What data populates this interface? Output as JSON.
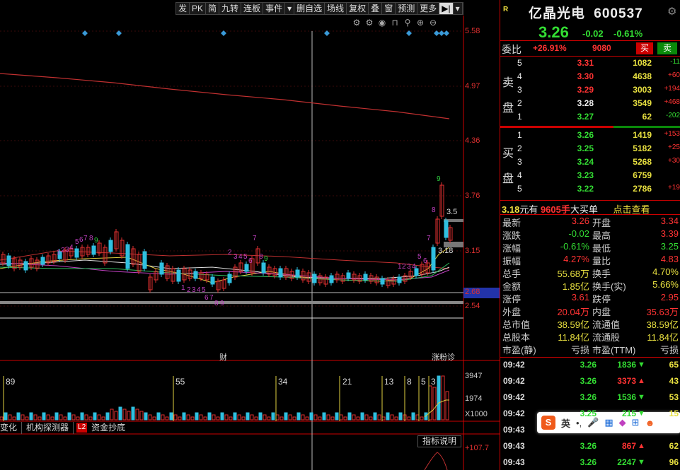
{
  "toolbar": {
    "items": [
      "发",
      "PK",
      "简",
      "九转",
      "连板",
      "事件",
      "▾",
      "删自选",
      "场线",
      "复权",
      "叠",
      "窗",
      "预测",
      "更多",
      "▶|",
      "▾"
    ]
  },
  "chart": {
    "price_axis": [
      "5.58",
      "4.97",
      "4.36",
      "3.76",
      "3.15",
      "2.68",
      "2.54"
    ],
    "vol_axis": [
      "3947",
      "1974",
      "X1000"
    ],
    "price_tag_3_5": "3.5",
    "price_tag_3_18": "3.18",
    "nine_seq_top": [
      "9",
      "8",
      "7",
      "6",
      "5"
    ],
    "label_cai": "财",
    "label_zhangyan": "涨粉诊",
    "vol_markers": [
      "89",
      "55",
      "34",
      "21",
      "13",
      "8",
      "5",
      "3"
    ],
    "indicator_val": "+107.7",
    "indicator_btn": "指标说明",
    "tabs": [
      "变化",
      "机构探测器",
      "L2",
      "资金抄底"
    ]
  },
  "quote": {
    "badge": "R",
    "name": "亿晶光电",
    "code": "600537",
    "price": "3.26",
    "change": "-0.02",
    "change_pct": "-0.61%",
    "weibi_label": "委比",
    "weibi_value": "+26.91%",
    "weibi_diff": "9080",
    "sell_btn": "买",
    "buy_btn": "卖",
    "sell_label": [
      "卖",
      "盘"
    ],
    "buy_label": [
      "买",
      "盘"
    ],
    "asks": [
      {
        "lvl": "5",
        "price": "3.31",
        "vol": "1082",
        "chg": "-11"
      },
      {
        "lvl": "4",
        "price": "3.30",
        "vol": "4638",
        "chg": "+60"
      },
      {
        "lvl": "3",
        "price": "3.29",
        "vol": "3003",
        "chg": "+194"
      },
      {
        "lvl": "2",
        "price": "3.28",
        "vol": "3549",
        "chg": "+468"
      },
      {
        "lvl": "1",
        "price": "3.27",
        "vol": "62",
        "chg": "-202"
      }
    ],
    "bids": [
      {
        "lvl": "1",
        "price": "3.26",
        "vol": "1419",
        "chg": "+153"
      },
      {
        "lvl": "2",
        "price": "3.25",
        "vol": "5182",
        "chg": "+25"
      },
      {
        "lvl": "3",
        "price": "3.24",
        "vol": "5268",
        "chg": "+30"
      },
      {
        "lvl": "4",
        "price": "3.23",
        "vol": "6759",
        "chg": ""
      },
      {
        "lvl": "5",
        "price": "3.22",
        "vol": "2786",
        "chg": "+19"
      }
    ],
    "bigorder": {
      "a": "3.18",
      "b": "元有",
      "c": "9605手",
      "d": "大买单",
      "e": "点击查看"
    },
    "stats": [
      {
        "k1": "最新",
        "v1": "3.26",
        "k2": "开盘",
        "v2": "3.34"
      },
      {
        "k1": "涨跌",
        "v1": "-0.02",
        "k2": "最高",
        "v2": "3.39"
      },
      {
        "k1": "涨幅",
        "v1": "-0.61%",
        "k2": "最低",
        "v2": "3.25"
      },
      {
        "k1": "振幅",
        "v1": "4.27%",
        "k2": "量比",
        "v2": "4.83"
      },
      {
        "k1": "总手",
        "v1": "55.68万",
        "k2": "换手",
        "v2": "4.70%"
      },
      {
        "k1": "金额",
        "v1": "1.85亿",
        "k2": "换手(实)",
        "v2": "5.66%"
      },
      {
        "k1": "涨停",
        "v1": "3.61",
        "k2": "跌停",
        "v2": "2.95"
      },
      {
        "k1": "外盘",
        "v1": "20.04万",
        "k2": "内盘",
        "v2": "35.63万"
      },
      {
        "k1": "总市值",
        "v1": "38.59亿",
        "k2": "流通值",
        "v2": "38.59亿"
      },
      {
        "k1": "总股本",
        "v1": "11.84亿",
        "k2": "流通股",
        "v2": "11.84亿"
      },
      {
        "k1": "市盈(静)",
        "v1": "亏损",
        "k2": "市盈(TTM)",
        "v2": "亏损"
      }
    ],
    "ticks": [
      {
        "t": "09:42",
        "p": "3.26",
        "v": "1836",
        "d": "down",
        "n": "65"
      },
      {
        "t": "09:42",
        "p": "3.26",
        "v": "3373",
        "d": "up",
        "n": "43"
      },
      {
        "t": "09:42",
        "p": "3.26",
        "v": "1536",
        "d": "down",
        "n": "53"
      },
      {
        "t": "09:42",
        "p": "3.25",
        "v": "215",
        "d": "down",
        "n": "15"
      },
      {
        "t": "09:43",
        "p": "",
        "v": "",
        "d": "",
        "n": ""
      },
      {
        "t": "09:43",
        "p": "3.26",
        "v": "867",
        "d": "up",
        "n": "62"
      },
      {
        "t": "09:43",
        "p": "3.26",
        "v": "2247",
        "d": "down",
        "n": "96"
      }
    ],
    "ime_label": "英"
  }
}
